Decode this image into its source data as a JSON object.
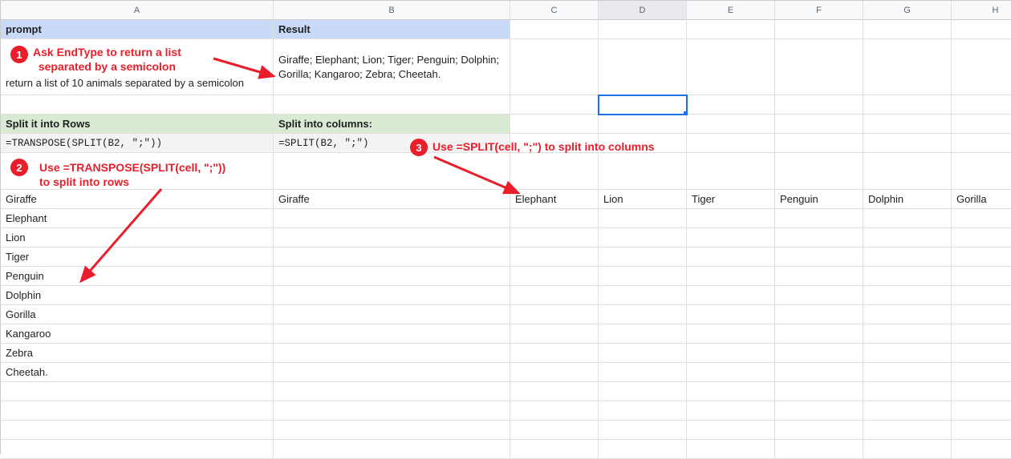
{
  "columns": [
    "A",
    "B",
    "C",
    "D",
    "E",
    "F",
    "G",
    "H"
  ],
  "active_column_index": 3,
  "headers": {
    "a1": "prompt",
    "b1": "Result",
    "a4_green": "Split it into Rows",
    "b4_green": "Split into columns:"
  },
  "prompt_row": {
    "a2": "return a list of 10 animals separated by a semicolon",
    "b2": "Giraffe; Elephant; Lion; Tiger; Penguin; Dolphin; Gorilla; Kangaroo; Zebra; Cheetah."
  },
  "formulas": {
    "a5": "=TRANSPOSE(SPLIT(B2, \";\"))",
    "b5": "=SPLIT(B2, \";\")"
  },
  "row_results": [
    "Giraffe",
    " Elephant",
    " Lion",
    " Tiger",
    " Penguin",
    " Dolphin",
    " Gorilla",
    " Kangaroo",
    " Zebra",
    " Cheetah."
  ],
  "col_results": [
    "Giraffe",
    " Elephant",
    " Lion",
    " Tiger",
    " Penguin",
    " Dolphin",
    " Gorilla"
  ],
  "annotations": {
    "a1_num": "1",
    "a1_text": "Ask EndType to return a list\nseparated by a semicolon",
    "a2_num": "2",
    "a2_text": "Use =TRANSPOSE(SPLIT(cell, \";\"))\nto split into rows",
    "a3_num": "3",
    "a3_text": "Use =SPLIT(cell, \";\") to split into columns"
  }
}
